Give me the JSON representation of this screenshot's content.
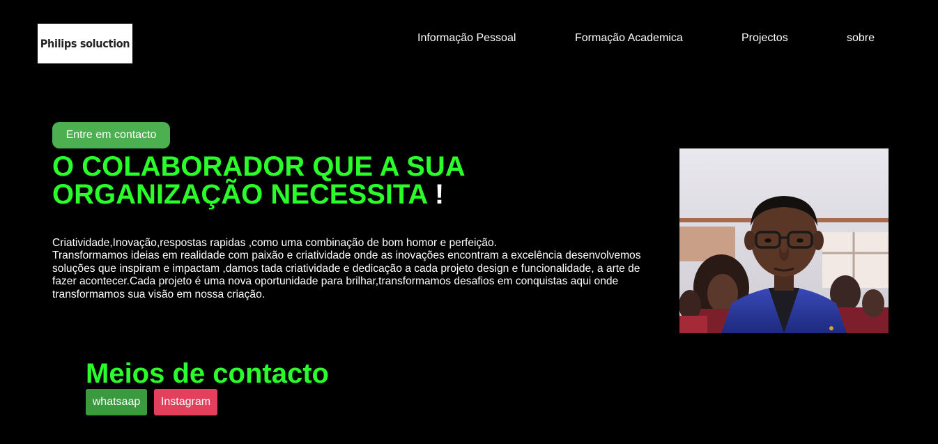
{
  "header": {
    "logo_text": "Philips soluction",
    "nav": [
      {
        "label": "Informação Pessoal"
      },
      {
        "label": "Formação Academica"
      },
      {
        "label": "Projectos"
      },
      {
        "label": "sobre"
      }
    ]
  },
  "hero": {
    "cta_label": "Entre em contacto",
    "headline_line1": "O COLABORADOR QUE A SUA",
    "headline_line2": "ORGANIZAÇÃO NECESSITA",
    "headline_bang": "!",
    "description_line1": "Criatividade,Inovação,respostas rapidas ,como uma combinação de bom homor e perfeição.",
    "description_rest": "Transformamos ideias em realidade com paixão e criatividade onde as inovações encontram a excelência desenvolvemos soluções que inspiram e impactam ,damos tada criatividade e dedicação a cada projeto design e funcionalidade, a arte de fazer acontecer.Cada projeto é uma nova oportunidade para brilhar,transformamos desafios em conquistas aqui onde transformamos sua visão em nossa criação."
  },
  "contact": {
    "title": "Meios de contacto",
    "whatsapp_label": "whatsaap",
    "instagram_label": "Instagram"
  },
  "colors": {
    "background": "#000000",
    "accent_green": "#2bff2b",
    "cta_green": "#4caf50",
    "whatsapp_green": "#3a9a3e",
    "instagram_pink": "#e3405e"
  }
}
